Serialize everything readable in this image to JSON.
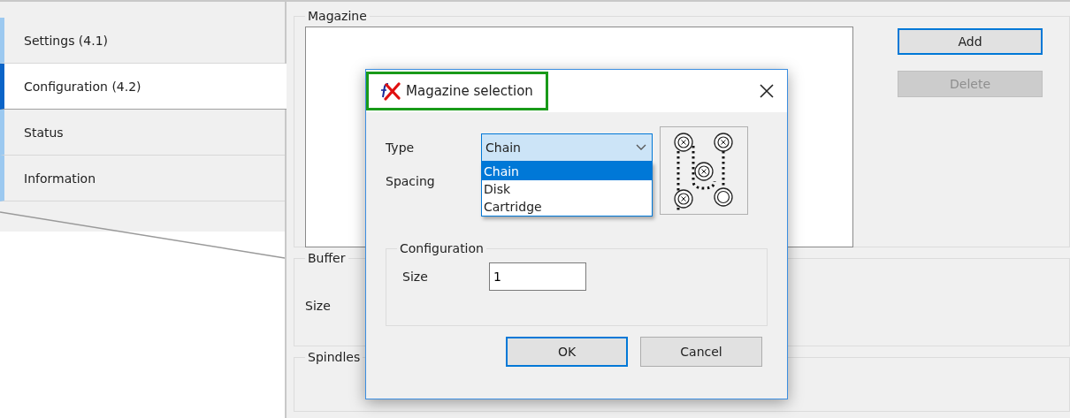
{
  "tabs": [
    {
      "label": "Settings (4.1)",
      "selected": false
    },
    {
      "label": "Configuration (4.2)",
      "selected": true
    },
    {
      "label": "Status",
      "selected": false
    },
    {
      "label": "Information",
      "selected": false
    }
  ],
  "magazine": {
    "title": "Magazine",
    "buttons": [
      {
        "label": "Add",
        "disabled": false,
        "default": true
      },
      {
        "label": "Delete",
        "disabled": true,
        "default": false
      }
    ]
  },
  "buffer": {
    "title": "Buffer",
    "size_label": "Size"
  },
  "spindles": {
    "title": "Spindles"
  },
  "dialog": {
    "title": "Magazine selection",
    "highlighted": true,
    "type_label": "Type",
    "type_value": "Chain",
    "expanded": true,
    "type_options": [
      {
        "label": "Chain",
        "selected": true
      },
      {
        "label": "Disk",
        "selected": false
      },
      {
        "label": "Cartridge",
        "selected": false
      }
    ],
    "spacing_label": "Spacing",
    "configuration": {
      "title": "Configuration",
      "size_label": "Size",
      "size_value": "1"
    },
    "buttons": [
      {
        "label": "OK",
        "default": true
      },
      {
        "label": "Cancel",
        "default": false
      }
    ]
  }
}
